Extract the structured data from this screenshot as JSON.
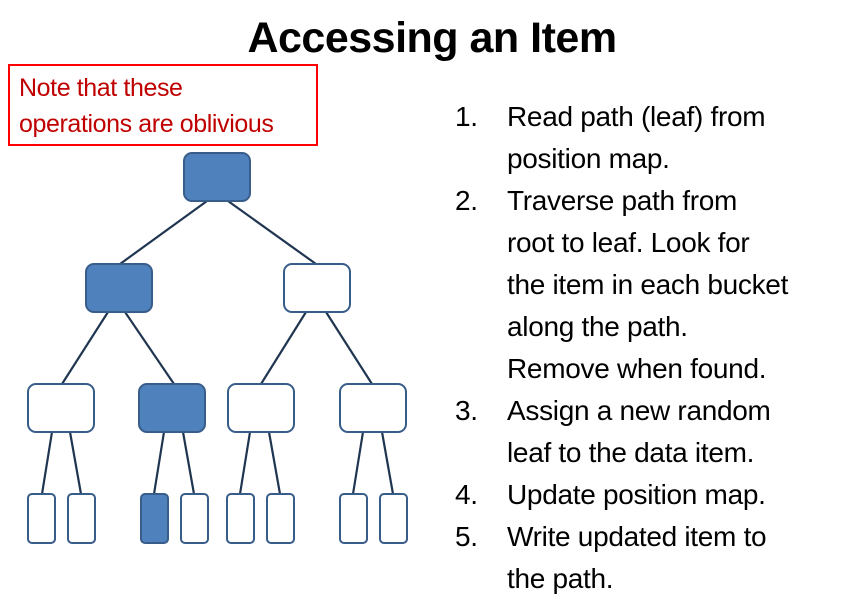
{
  "title": "Accessing an Item",
  "note": {
    "lines": [
      "Note that these",
      "operations are oblivious"
    ]
  },
  "steps": [
    {
      "num": "1.",
      "lines": [
        "Read path (leaf) from",
        "position map."
      ]
    },
    {
      "num": "2.",
      "lines": [
        "Traverse path from",
        "root to leaf. Look for",
        "the item in each bucket",
        "along the path.",
        "Remove when found."
      ]
    },
    {
      "num": "3.",
      "lines": [
        "Assign a new random",
        "leaf to the data item."
      ]
    },
    {
      "num": "4.",
      "lines": [
        "Update position map."
      ]
    },
    {
      "num": "5.",
      "lines": [
        "Write updated item to",
        "the path."
      ]
    }
  ],
  "tree": {
    "colors": {
      "filled": "#4F81BD",
      "stroke": "#385D8A",
      "edge": "#1F3550",
      "empty": "#FFFFFF"
    },
    "levels": [
      {
        "filled": [
          true
        ]
      },
      {
        "filled": [
          true,
          false
        ]
      },
      {
        "filled": [
          false,
          true,
          false,
          false
        ]
      },
      {
        "filled": [
          false,
          false,
          true,
          false,
          false,
          false,
          false,
          false
        ]
      }
    ]
  }
}
